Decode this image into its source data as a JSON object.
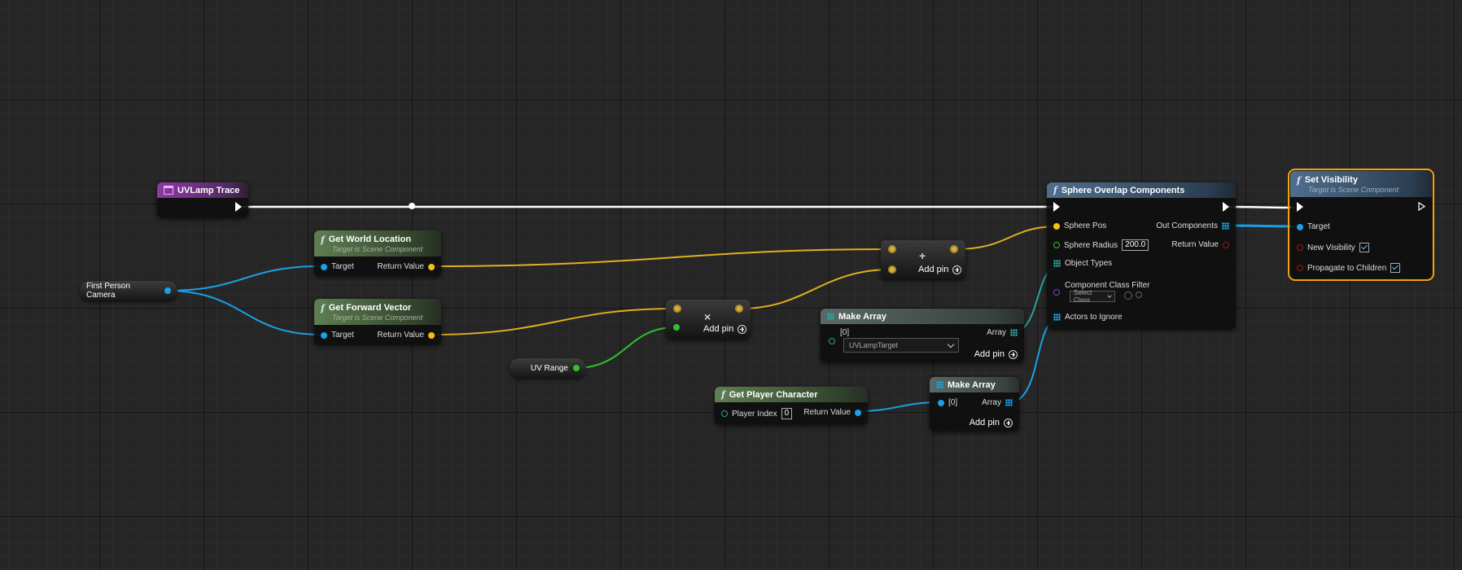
{
  "nodes": {
    "uvlamp_trace": {
      "title": "UVLamp Trace"
    },
    "first_person_camera": {
      "label": "First Person Camera"
    },
    "uv_range": {
      "label": "UV Range"
    },
    "get_world_location": {
      "title": "Get World Location",
      "subtitle": "Target is Scene Component",
      "in_target": "Target",
      "out_return": "Return Value"
    },
    "get_forward_vector": {
      "title": "Get Forward Vector",
      "subtitle": "Target is Scene Component",
      "in_target": "Target",
      "out_return": "Return Value"
    },
    "add_node": {
      "symbol": "+",
      "add_pin": "Add pin"
    },
    "multiply_node": {
      "symbol": "×",
      "add_pin": "Add pin"
    },
    "make_array_1": {
      "title": "Make Array",
      "index": "[0]",
      "out": "Array",
      "select_value": "UVLampTarget",
      "add_pin": "Add pin"
    },
    "get_player_character": {
      "title": "Get Player Character",
      "player_index_label": "Player Index",
      "player_index_value": "0",
      "out_return": "Return Value"
    },
    "make_array_2": {
      "title": "Make Array",
      "index": "[0]",
      "out": "Array",
      "add_pin": "Add pin"
    },
    "sphere_overlap": {
      "title": "Sphere Overlap Components",
      "sphere_pos": "Sphere Pos",
      "sphere_radius": "Sphere Radius",
      "sphere_radius_value": "200.0",
      "object_types": "Object Types",
      "component_class_filter": "Component Class Filter",
      "select_class": "Select Class",
      "actors_to_ignore": "Actors to Ignore",
      "out_components": "Out Components",
      "return_value": "Return Value"
    },
    "set_visibility": {
      "title": "Set Visibility",
      "subtitle": "Target is Scene Component",
      "target": "Target",
      "new_visibility": "New Visibility",
      "propagate": "Propagate to Children"
    }
  },
  "colors": {
    "exec": "#ffffff",
    "object": "#1aa0e6",
    "vector": "#f3c014",
    "float": "#31c02e",
    "selection": "#f3a10c"
  }
}
